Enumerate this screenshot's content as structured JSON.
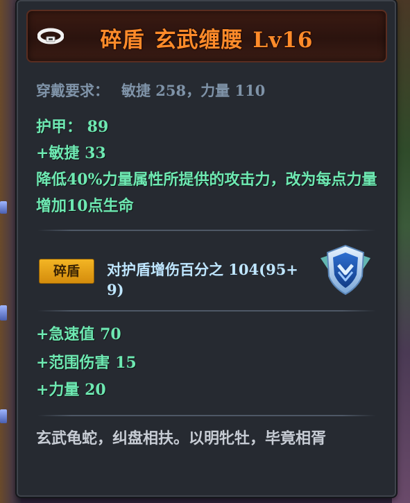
{
  "item": {
    "title_name": "碎盾",
    "title_slot": "玄武缠腰",
    "title_level": "Lv16",
    "icon": "belt-icon"
  },
  "requirements": {
    "label": "穿戴要求：",
    "value": "敏捷 258，力量 110"
  },
  "base_stats": {
    "armor": "护甲： 89",
    "agility": "+敏捷 33",
    "description": "降低40%力量属性所提供的攻击力，改为每点力量增加10点生命"
  },
  "special": {
    "tag": "碎盾",
    "effect": "对护盾增伤百分之 104(95+9)",
    "emblem_icon": "shield-emblem-icon"
  },
  "bonus_stats": [
    "+急速值 70",
    "+范围伤害 15",
    "+力量 20"
  ],
  "flavor_text": "玄武龟蛇，纠盘相扶。以明牝牡，毕竟相胥",
  "colors": {
    "title": "#ff8b2a",
    "stat_green": "#6ee8b2",
    "requirement": "#7f93a8",
    "tag_gold": "#e3a018",
    "effect_text": "#bfe6ff",
    "flavor": "#c7ccd4"
  }
}
